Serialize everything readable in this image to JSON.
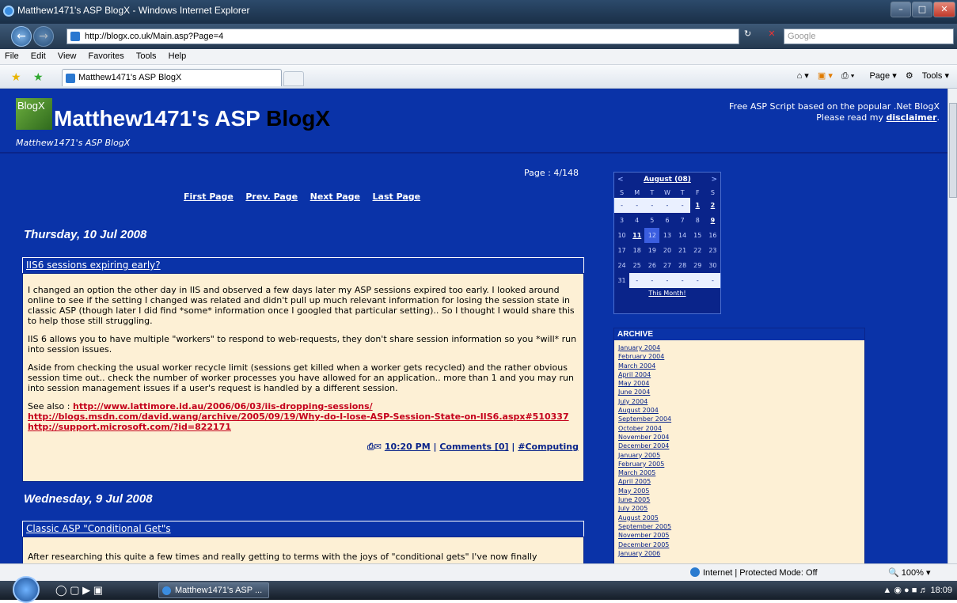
{
  "window": {
    "title": "Matthew1471's ASP BlogX - Windows Internet Explorer",
    "address": "http://blogx.co.uk/Main.asp?Page=4",
    "search_placeholder": "Google",
    "menu": [
      "File",
      "Edit",
      "View",
      "Favorites",
      "Tools",
      "Help"
    ],
    "tab_title": "Matthew1471's ASP BlogX",
    "cmd": {
      "page": "Page",
      "tools": "Tools"
    }
  },
  "site": {
    "logo_text": "BlogX",
    "title_main": "Matthew1471's ASP ",
    "title_accent": "BlogX",
    "subtitle": "Matthew1471's ASP BlogX",
    "tagline": "Free ASP Script based on the popular .Net BlogX",
    "disclaimer_prefix": "Please read my ",
    "disclaimer_link": "disclaimer",
    "disclaimer_suffix": "."
  },
  "paging": {
    "info": "Page : 4/148",
    "links": [
      "First Page",
      "Prev. Page",
      "Next Page",
      "Last Page"
    ]
  },
  "posts": [
    {
      "date": "Thursday, 10 Jul 2008",
      "title": "IIS6 sessions expiring early?",
      "paragraphs": [
        "I changed an option the other day in IIS and observed a few days later my ASP sessions expired too early. I looked around online to see if the setting I changed was related and didn't pull up much relevant information for losing the session state in classic ASP (though later I did find *some* information once I googled that particular setting).. So I thought I would share this to help those still struggling.",
        "IIS 6 allows you to have multiple \"workers\" to respond to web-requests, they don't share session information so you *will* run into session issues.",
        "Aside from checking the usual worker recycle limit (sessions get killed when a worker gets recycled) and the rather obvious session time out.. check the number of worker processes you have allowed for an application.. more than 1 and you may run into session management issues if a user's request is handled by a different session."
      ],
      "see_also_label": "See also : ",
      "links": [
        "http://www.lattimore.id.au/2006/06/03/iis-dropping-sessions/",
        "http://blogs.msdn.com/david.wang/archive/2005/09/19/Why-do-I-lose-ASP-Session-State-on-IIS6.aspx#510337",
        "http://support.microsoft.com/?id=822171"
      ],
      "time": "10:20 PM",
      "comments": "Comments [0]",
      "category": "#Computing"
    },
    {
      "date": "Wednesday, 9 Jul 2008",
      "title": "Classic ASP \"Conditional Get\"s",
      "paragraphs": [
        "After researching this quite a few times and really getting to terms with the joys of \"conditional gets\" I've now finally"
      ]
    }
  ],
  "calendar": {
    "month": "August",
    "year_short": "(08)",
    "prev": "<",
    "next": ">",
    "dow": [
      "S",
      "M",
      "T",
      "W",
      "T",
      "F",
      "S"
    ],
    "weeks": [
      [
        "-",
        "-",
        "-",
        "-",
        "-",
        "1",
        "2"
      ],
      [
        "3",
        "4",
        "5",
        "6",
        "7",
        "8",
        "9"
      ],
      [
        "10",
        "11",
        "12",
        "13",
        "14",
        "15",
        "16"
      ],
      [
        "17",
        "18",
        "19",
        "20",
        "21",
        "22",
        "23"
      ],
      [
        "24",
        "25",
        "26",
        "27",
        "28",
        "29",
        "30"
      ],
      [
        "31",
        "-",
        "-",
        "-",
        "-",
        "-",
        "-"
      ]
    ],
    "linked_days": [
      "1",
      "2",
      "9",
      "11"
    ],
    "today": "12",
    "footer": "This Month!"
  },
  "archive": {
    "heading": "ARCHIVE",
    "items": [
      "January 2004",
      "February 2004",
      "March 2004",
      "April 2004",
      "May 2004",
      "June 2004",
      "July 2004",
      "August 2004",
      "September 2004",
      "October 2004",
      "November 2004",
      "December 2004",
      "January 2005",
      "February 2005",
      "March 2005",
      "April 2005",
      "May 2005",
      "June 2005",
      "July 2005",
      "August 2005",
      "September 2005",
      "November 2005",
      "December 2005",
      "January 2006"
    ]
  },
  "statusbar": {
    "zone": "Internet | Protected Mode: Off",
    "zoom": "100%"
  },
  "taskbar": {
    "task_label": "Matthew1471's ASP ...",
    "clock": "18:09"
  }
}
